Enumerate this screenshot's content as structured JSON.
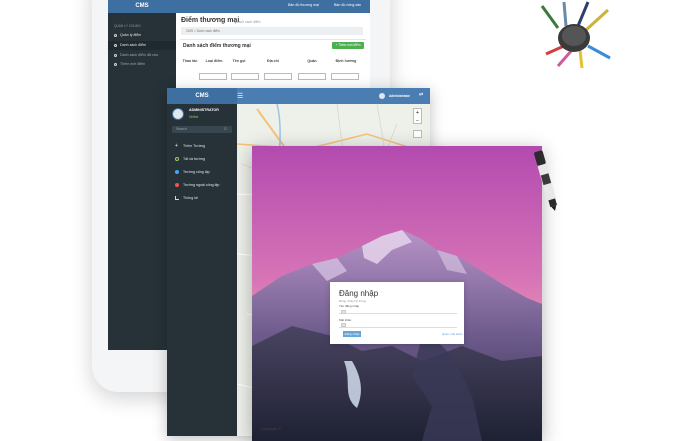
{
  "cms_tablet": {
    "logo": "CMS",
    "top_links": [
      "Bản đồ thương mại",
      "Bản đồ nông sản"
    ],
    "sidebar_section": "QUẢN LÝ CHUNG",
    "sidebar_items": [
      "Quản lý điểm",
      "Danh sách điểm",
      "Danh sách điểm đã xóa",
      "Thêm mới điểm"
    ],
    "page_title": "Điểm thương mại",
    "page_subtitle": "Danh sách điểm",
    "breadcrumb": "CMS > Danh sách điểm",
    "panel_title": "Danh sách điểm thương mại",
    "add_button": "+ Thêm mới điểm",
    "columns": [
      "Thao tác",
      "Loại điểm",
      "Tên gọi",
      "Địa chỉ",
      "Quận",
      "Định hướng"
    ]
  },
  "cms_window": {
    "logo": "CMS",
    "menu_icon": "hamburger-icon",
    "top_user": "Administrator",
    "user_name": "ADMINISTRATOR",
    "user_status": "Online",
    "search_placeholder": "Search",
    "menu": [
      "Thêm Trường",
      "Tất cả trường",
      "Trường công lập",
      "Trường ngoài công lập",
      "Thống kê"
    ],
    "map_controls": [
      "+",
      "−"
    ],
    "copyright": "Copyright ©"
  },
  "login": {
    "title": "Đăng nhập",
    "subtitle": "Đăng nhập hệ thống",
    "username_label": "Tên đăng nhập",
    "password_label": "Mật khẩu",
    "submit": "Đăng nhập",
    "forgot": "Quên mật khẩu"
  },
  "colors": {
    "sidebar": "#263238",
    "header": "#3d6fa1",
    "success": "#4caf50",
    "sky_top": "#c04fb8",
    "sky_bottom": "#e9a0b8"
  }
}
